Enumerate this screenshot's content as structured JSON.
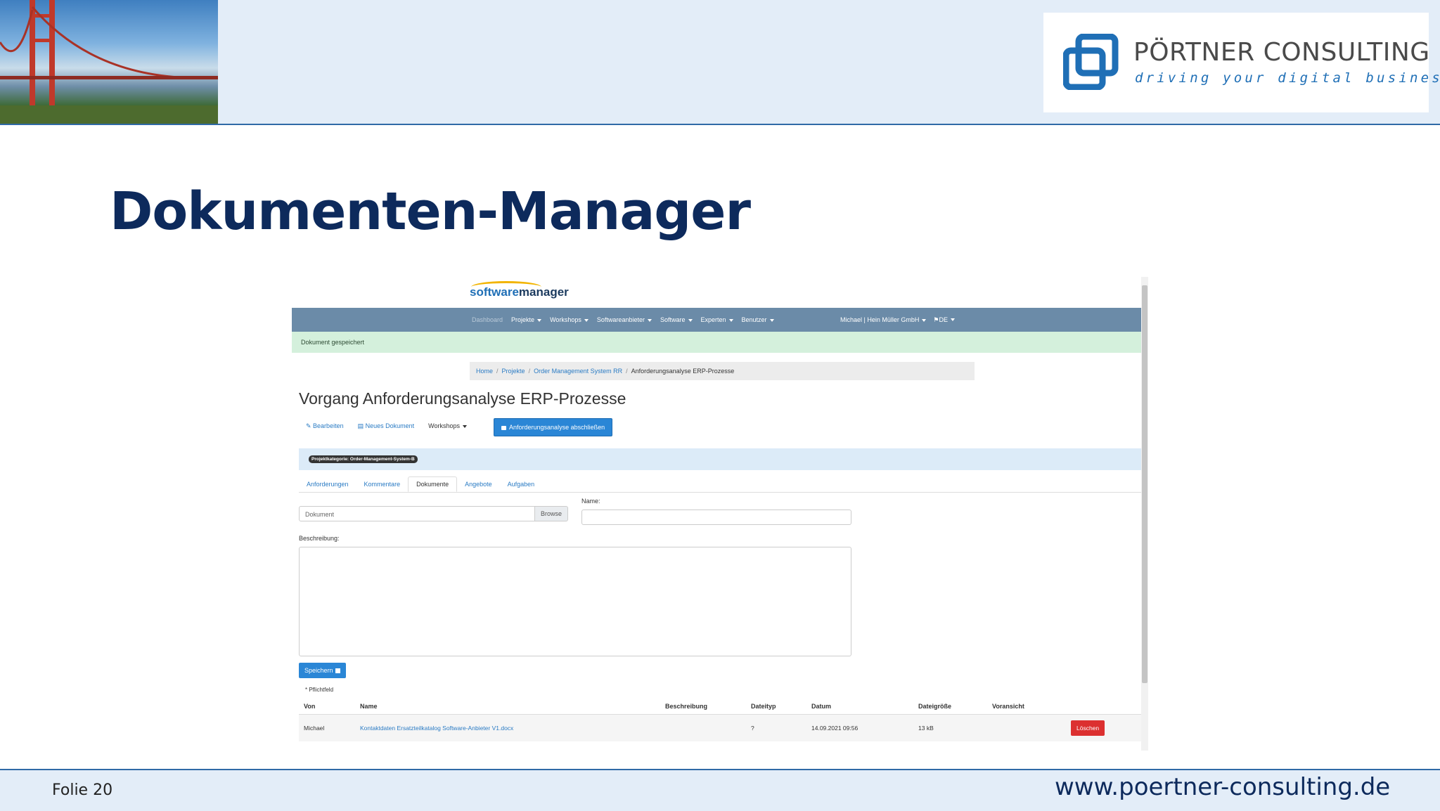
{
  "slide": {
    "title": "Dokumenten-Manager",
    "folie": "Folie 20",
    "website": "www.poertner-consulting.de"
  },
  "brand": {
    "name": "PÖRTNER CONSULTING",
    "tagline": "driving your digital business",
    "primary_color": "#1f6fb6",
    "title_color": "#0d2a5c"
  },
  "app": {
    "logo_part1": "software",
    "logo_part2": "manager",
    "nav": {
      "dashboard": "Dashboard",
      "projekte": "Projekte",
      "workshops": "Workshops",
      "softwareanbieter": "Softwareanbieter",
      "software": "Software",
      "experten": "Experten",
      "benutzer": "Benutzer",
      "user": "Michael | Hein Müller GmbH",
      "lang": "DE"
    },
    "alert": "Dokument gespeichert",
    "breadcrumb": {
      "home": "Home",
      "projekte": "Projekte",
      "project": "Order Management System RR",
      "current": "Anforderungsanalyse ERP-Prozesse"
    },
    "page_title": "Vorgang Anforderungsanalyse ERP-Prozesse",
    "actions": {
      "edit": "Bearbeiten",
      "new_doc": "Neues Dokument",
      "workshops": "Workshops",
      "close_btn": "Anforderungsanalyse abschließen"
    },
    "category_badge": "Projektkategorie: Order-Management-System-B",
    "tabs": [
      "Anforderungen",
      "Kommentare",
      "Dokumente",
      "Angebote",
      "Aufgaben"
    ],
    "active_tab": "Dokumente",
    "form": {
      "file_placeholder": "Dokument",
      "browse": "Browse",
      "name_label": "Name:",
      "name_value": "",
      "desc_label": "Beschreibung:",
      "desc_value": "",
      "save": "Speichern",
      "required_note": "* Pflichtfeld"
    },
    "table": {
      "headers": [
        "Von",
        "Name",
        "Beschreibung",
        "Dateityp",
        "Datum",
        "Dateigröße",
        "Voransicht"
      ],
      "rows": [
        {
          "von": "Michael",
          "name": "Kontaktdaten Ersatzteilkatalog Software-Anbieter V1.docx",
          "beschreibung": "",
          "dateityp": "?",
          "datum": "14.09.2021 09:56",
          "groesse": "13 kB",
          "voransicht": "",
          "delete": "Löschen"
        }
      ]
    }
  }
}
